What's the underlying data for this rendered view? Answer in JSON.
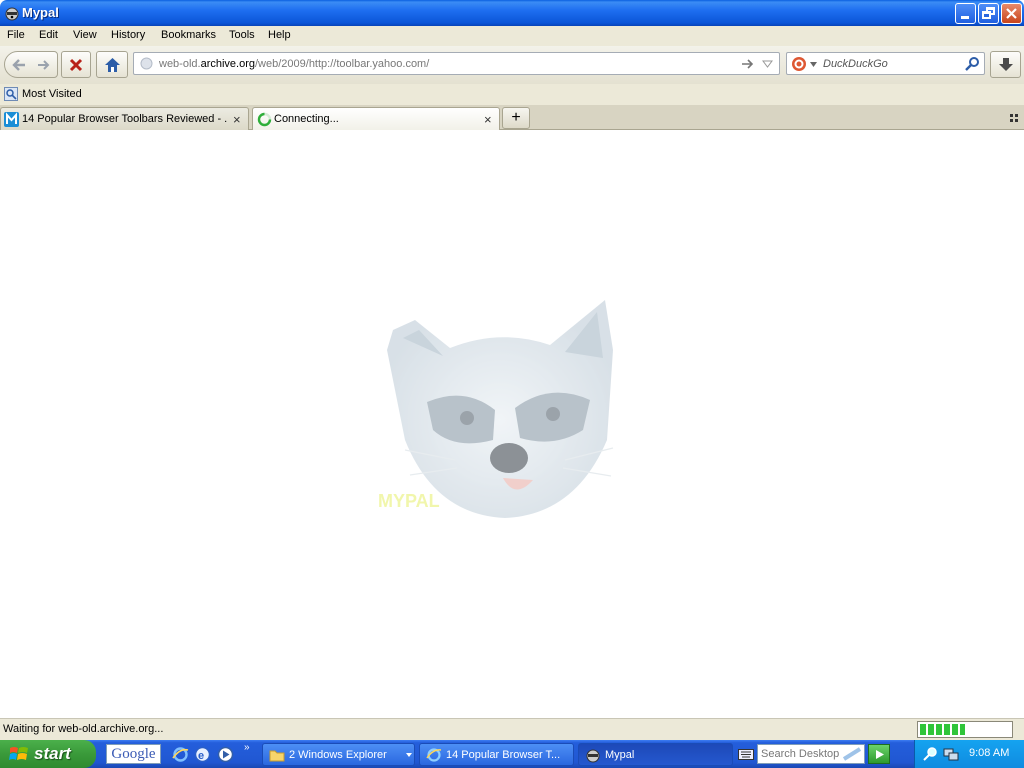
{
  "window": {
    "title": "Mypal"
  },
  "menu": [
    "File",
    "Edit",
    "View",
    "History",
    "Bookmarks",
    "Tools",
    "Help"
  ],
  "urlbar": {
    "prefix": "web-old.",
    "domain": "archive.org",
    "path": "/web/2009/http://toolbar.yahoo.com/"
  },
  "search": {
    "placeholder": "DuckDuckGo"
  },
  "bookmarks": {
    "most_visited": "Most Visited"
  },
  "tabs": [
    {
      "label": "14 Popular Browser Toolbars Reviewed - ...",
      "active": false
    },
    {
      "label": "Connecting...",
      "active": true
    }
  ],
  "status": {
    "text": "Waiting for web-old.archive.org...",
    "progress_percent": 50
  },
  "taskbar": {
    "start": "start",
    "google": "Google",
    "buttons": [
      "2 Windows Explorer",
      "14 Popular Browser T...",
      "Mypal"
    ],
    "desktop_search_placeholder": "Search Desktop",
    "clock": "9:08 AM"
  },
  "colors": {
    "titlebar": "#0b55d8",
    "taskbar": "#245edb",
    "start": "#3a9a3a",
    "progress": "#2fc53a"
  }
}
